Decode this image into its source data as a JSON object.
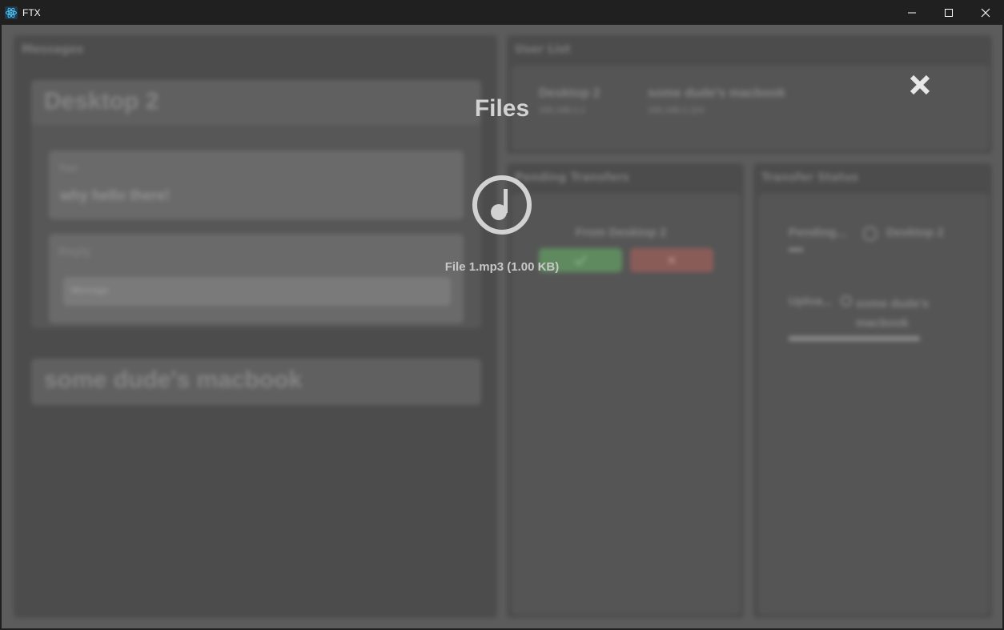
{
  "window": {
    "title": "FTX",
    "controls": {
      "minimize": "minimize-icon",
      "maximize": "maximize-icon",
      "close": "close-icon"
    }
  },
  "colors": {
    "titlebar_bg": "#202020",
    "app_bg": "#5c5c5c",
    "overlay_text": "#d2d2d2",
    "accept": "#5f8a5f",
    "reject": "#8a5c58",
    "app_icon": "#4fc3f7"
  },
  "messages": {
    "title": "Messages",
    "conversations": [
      {
        "name": "Desktop 2",
        "from_label": "Yoo",
        "message": "why hello there!",
        "reply_label": "Reply",
        "input_placeholder": "Message"
      },
      {
        "name": "some dude's macbook"
      }
    ]
  },
  "user_list": {
    "title": "User List",
    "users": [
      {
        "name": "Desktop 2",
        "ip": "192.168.1.1"
      },
      {
        "name": "some dude's macbook",
        "ip": "192.168.1.124"
      }
    ]
  },
  "pending_transfers": {
    "title": "Pending Transfers",
    "from_label": "From Desktop 2",
    "accept_icon": "check-icon",
    "reject_icon": "x-icon"
  },
  "transfer_status": {
    "title": "Transfer Status",
    "items": [
      {
        "status": "Pending...",
        "peer": "Desktop 2"
      },
      {
        "status": "Uploa...",
        "peer": "some dude's macbook"
      }
    ]
  },
  "overlay": {
    "title": "Files",
    "close_icon": "close-icon",
    "files": [
      {
        "name": "File 1.mp3 (1.00 KB)",
        "icon": "music-note-icon"
      }
    ]
  }
}
